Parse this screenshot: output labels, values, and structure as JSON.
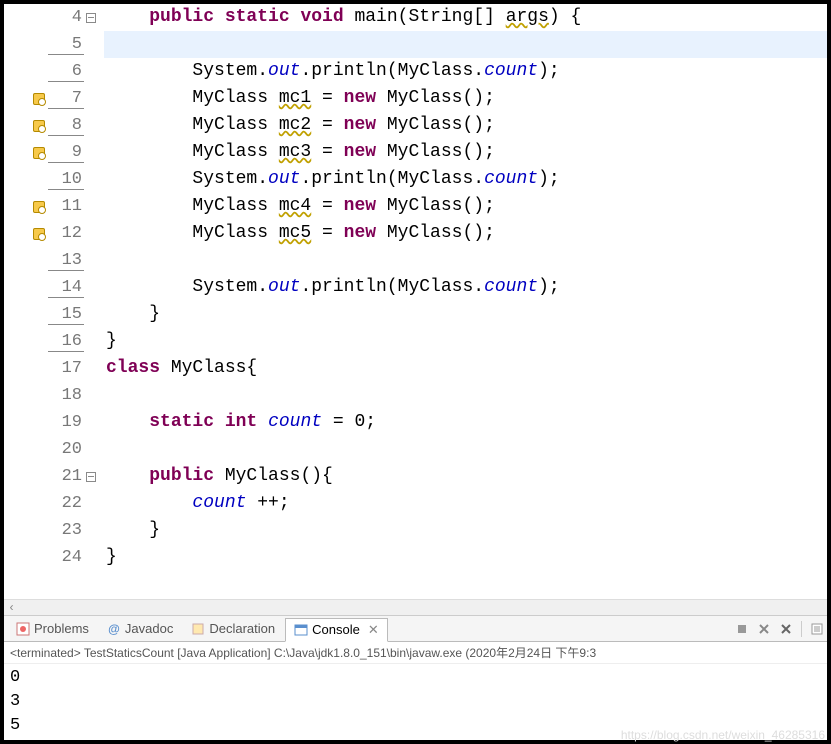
{
  "editor": {
    "lines": [
      {
        "num": 4,
        "fold": true,
        "marker": "",
        "tokens": [
          {
            "t": "    ",
            "c": "plain"
          },
          {
            "t": "public static void",
            "c": "kw"
          },
          {
            "t": " main(String[] ",
            "c": "plain"
          },
          {
            "t": "args",
            "c": "var-underline"
          },
          {
            "t": ") {",
            "c": "plain"
          }
        ]
      },
      {
        "num": 5,
        "current": true,
        "underline": true,
        "tokens": [
          {
            "t": "        ",
            "c": "plain"
          }
        ]
      },
      {
        "num": 6,
        "underline": true,
        "tokens": [
          {
            "t": "        System.",
            "c": "plain"
          },
          {
            "t": "out",
            "c": "field"
          },
          {
            "t": ".println(MyClass.",
            "c": "plain"
          },
          {
            "t": "count",
            "c": "field"
          },
          {
            "t": ");",
            "c": "plain"
          }
        ]
      },
      {
        "num": 7,
        "marker": "warning",
        "underline": true,
        "tokens": [
          {
            "t": "        MyClass ",
            "c": "plain"
          },
          {
            "t": "mc1",
            "c": "var-underline"
          },
          {
            "t": " = ",
            "c": "plain"
          },
          {
            "t": "new",
            "c": "kw"
          },
          {
            "t": " MyClass();",
            "c": "plain"
          }
        ]
      },
      {
        "num": 8,
        "marker": "warning",
        "underline": true,
        "tokens": [
          {
            "t": "        MyClass ",
            "c": "plain"
          },
          {
            "t": "mc2",
            "c": "var-underline"
          },
          {
            "t": " = ",
            "c": "plain"
          },
          {
            "t": "new",
            "c": "kw"
          },
          {
            "t": " MyClass();",
            "c": "plain"
          }
        ]
      },
      {
        "num": 9,
        "marker": "warning",
        "underline": true,
        "tokens": [
          {
            "t": "        MyClass ",
            "c": "plain"
          },
          {
            "t": "mc3",
            "c": "var-underline"
          },
          {
            "t": " = ",
            "c": "plain"
          },
          {
            "t": "new",
            "c": "kw"
          },
          {
            "t": " MyClass();",
            "c": "plain"
          }
        ]
      },
      {
        "num": 10,
        "underline": true,
        "tokens": [
          {
            "t": "        System.",
            "c": "plain"
          },
          {
            "t": "out",
            "c": "field"
          },
          {
            "t": ".println(MyClass.",
            "c": "plain"
          },
          {
            "t": "count",
            "c": "field"
          },
          {
            "t": ");",
            "c": "plain"
          }
        ]
      },
      {
        "num": 11,
        "marker": "warning",
        "tokens": [
          {
            "t": "        MyClass ",
            "c": "plain"
          },
          {
            "t": "mc4",
            "c": "var-underline"
          },
          {
            "t": " = ",
            "c": "plain"
          },
          {
            "t": "new",
            "c": "kw"
          },
          {
            "t": " MyClass();",
            "c": "plain"
          }
        ]
      },
      {
        "num": 12,
        "marker": "warning",
        "tokens": [
          {
            "t": "        MyClass ",
            "c": "plain"
          },
          {
            "t": "mc5",
            "c": "var-underline"
          },
          {
            "t": " = ",
            "c": "plain"
          },
          {
            "t": "new",
            "c": "kw"
          },
          {
            "t": " MyClass();",
            "c": "plain"
          }
        ]
      },
      {
        "num": 13,
        "underline": true,
        "tokens": [
          {
            "t": "",
            "c": "plain"
          }
        ]
      },
      {
        "num": 14,
        "underline": true,
        "tokens": [
          {
            "t": "        System.",
            "c": "plain"
          },
          {
            "t": "out",
            "c": "field"
          },
          {
            "t": ".println(MyClass.",
            "c": "plain"
          },
          {
            "t": "count",
            "c": "field"
          },
          {
            "t": ");",
            "c": "plain"
          }
        ]
      },
      {
        "num": 15,
        "underline": true,
        "tokens": [
          {
            "t": "    }",
            "c": "plain"
          }
        ]
      },
      {
        "num": 16,
        "underline": true,
        "tokens": [
          {
            "t": "}",
            "c": "plain"
          }
        ]
      },
      {
        "num": 17,
        "tokens": [
          {
            "t": "class",
            "c": "kw"
          },
          {
            "t": " MyClass{",
            "c": "plain"
          }
        ]
      },
      {
        "num": 18,
        "tokens": [
          {
            "t": "",
            "c": "plain"
          }
        ]
      },
      {
        "num": 19,
        "tokens": [
          {
            "t": "    ",
            "c": "plain"
          },
          {
            "t": "static int",
            "c": "kw"
          },
          {
            "t": " ",
            "c": "plain"
          },
          {
            "t": "count",
            "c": "field"
          },
          {
            "t": " = 0;",
            "c": "plain"
          }
        ]
      },
      {
        "num": 20,
        "tokens": [
          {
            "t": "",
            "c": "plain"
          }
        ]
      },
      {
        "num": 21,
        "fold": true,
        "tokens": [
          {
            "t": "    ",
            "c": "plain"
          },
          {
            "t": "public",
            "c": "kw"
          },
          {
            "t": " MyClass(){",
            "c": "plain"
          }
        ]
      },
      {
        "num": 22,
        "tokens": [
          {
            "t": "        ",
            "c": "plain"
          },
          {
            "t": "count",
            "c": "field"
          },
          {
            "t": " ++;",
            "c": "plain"
          }
        ]
      },
      {
        "num": 23,
        "tokens": [
          {
            "t": "    }",
            "c": "plain"
          }
        ]
      },
      {
        "num": 24,
        "tokens": [
          {
            "t": "}",
            "c": "plain"
          }
        ]
      }
    ],
    "scroll_hint": "‹"
  },
  "tabs": {
    "problems": "Problems",
    "javadoc": "Javadoc",
    "declaration": "Declaration",
    "console": "Console",
    "console_close": "✕"
  },
  "console": {
    "status": "<terminated> TestStaticsCount [Java Application] C:\\Java\\jdk1.8.0_151\\bin\\javaw.exe (2020年2月24日 下午9:3",
    "output": [
      "0",
      "3",
      "5"
    ]
  },
  "watermark": "https://blog.csdn.net/weixin_46285316"
}
